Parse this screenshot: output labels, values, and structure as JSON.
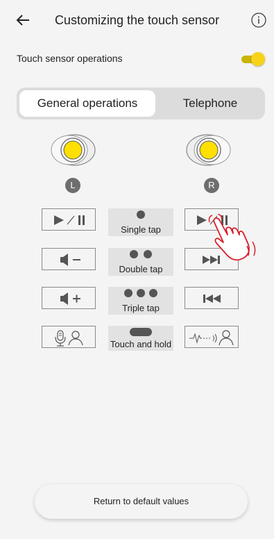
{
  "header": {
    "title": "Customizing the touch sensor",
    "back_icon": "arrow-left-icon",
    "info_icon": "info-icon"
  },
  "touch_sensor": {
    "label": "Touch sensor operations",
    "enabled": true,
    "toggle_color": "#f7d318"
  },
  "tabs": [
    {
      "label": "General operations",
      "selected": true
    },
    {
      "label": "Telephone",
      "selected": false
    }
  ],
  "earbuds": {
    "left_label": "L",
    "right_label": "R",
    "accent": "#ffe000"
  },
  "rows": [
    {
      "gesture": "Single tap",
      "dots": 1,
      "left_icon": "play-pause-icon",
      "right_icon": "play-pause-icon"
    },
    {
      "gesture": "Double tap",
      "dots": 2,
      "left_icon": "volume-down-icon",
      "right_icon": "next-track-icon"
    },
    {
      "gesture": "Triple tap",
      "dots": 3,
      "left_icon": "volume-up-icon",
      "right_icon": "previous-track-icon"
    },
    {
      "gesture": "Touch and hold",
      "dots": 0,
      "left_icon": "voice-assistant-icon",
      "right_icon": "ambient-sound-icon"
    }
  ],
  "reset_button": {
    "label": "Return to default values"
  }
}
